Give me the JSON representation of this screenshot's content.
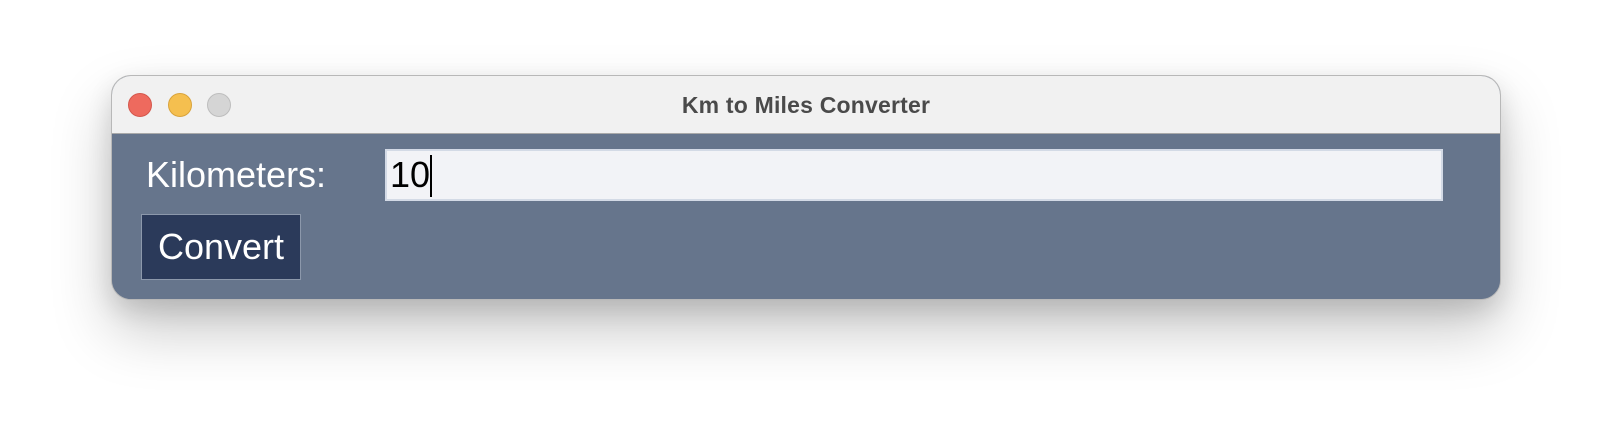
{
  "window": {
    "title": "Km to Miles Converter",
    "controls": {
      "close": "close-icon",
      "minimize": "minimize-icon",
      "zoom": "zoom-icon"
    }
  },
  "form": {
    "km_label": "Kilometers:",
    "km_value": "10",
    "convert_label": "Convert"
  },
  "colors": {
    "content_background": "#66758c",
    "button_background": "#2b3a5a",
    "input_background": "#f2f3f7",
    "titlebar_background": "#f1f1f1",
    "close_red": "#ee6a5e",
    "minimize_yellow": "#f5bf4f",
    "zoom_gray": "#d5d5d5"
  }
}
